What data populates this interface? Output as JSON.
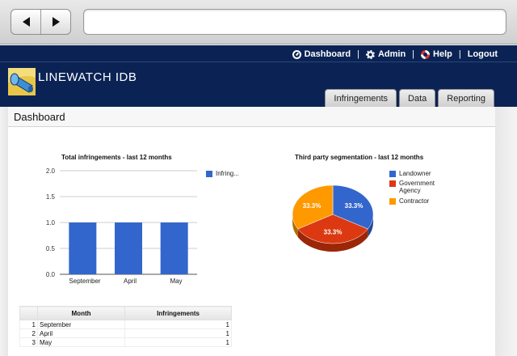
{
  "browser": {
    "back_icon": "back-arrow-icon",
    "forward_icon": "forward-arrow-icon",
    "url": ""
  },
  "app": {
    "brand": "LINEWATCH IDB",
    "top_nav": [
      {
        "label": "Dashboard",
        "icon": "dashboard-icon"
      },
      {
        "label": "Admin",
        "icon": "gear-icon"
      },
      {
        "label": "Help",
        "icon": "lifebuoy-icon"
      },
      {
        "label": "Logout"
      }
    ],
    "tabs": [
      "Infringements",
      "Data",
      "Reporting"
    ]
  },
  "page": {
    "title": "Dashboard"
  },
  "charts": {
    "bar": {
      "type": "bar",
      "title": "Total infringements - last 12 months",
      "categories": [
        "September",
        "April",
        "May"
      ],
      "values": [
        1,
        1,
        1
      ],
      "ylim": [
        0,
        2
      ],
      "yticks": [
        "2.0",
        "1.5",
        "1.0",
        "0.5",
        "0.0"
      ],
      "legend": "Infring...",
      "color": "#3366cc"
    },
    "pie": {
      "type": "pie",
      "title": "Third party segmentation - last 12 months",
      "slices": [
        {
          "name": "Landowner",
          "value": 33.3,
          "label": "33.3%",
          "color": "#3366cc"
        },
        {
          "name": "Government Agency",
          "value": 33.3,
          "label": "33.3%",
          "color": "#dc3912"
        },
        {
          "name": "Contractor",
          "value": 33.3,
          "label": "33.3%",
          "color": "#ff9900"
        }
      ]
    }
  },
  "chart_data": [
    {
      "type": "bar",
      "title": "Total infringements - last 12 months",
      "categories": [
        "September",
        "April",
        "May"
      ],
      "series": [
        {
          "name": "Infring...",
          "values": [
            1,
            1,
            1
          ]
        }
      ],
      "ylim": [
        0,
        2
      ],
      "legend": "right"
    },
    {
      "type": "pie",
      "title": "Third party segmentation - last 12 months",
      "categories": [
        "Landowner",
        "Government Agency",
        "Contractor"
      ],
      "values": [
        33.3,
        33.3,
        33.3
      ],
      "legend": "right"
    }
  ],
  "table": {
    "headers": [
      "Month",
      "Infringements"
    ],
    "rows": [
      {
        "n": "1",
        "month": "September",
        "count": "1"
      },
      {
        "n": "2",
        "month": "April",
        "count": "1"
      },
      {
        "n": "3",
        "month": "May",
        "count": "1"
      }
    ]
  }
}
